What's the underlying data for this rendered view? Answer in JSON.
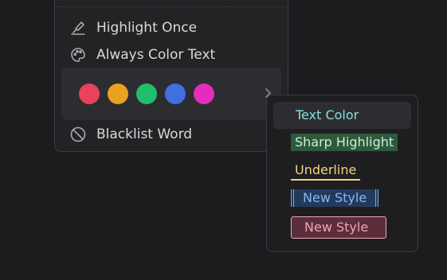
{
  "menu": {
    "items": [
      {
        "label": "Highlight Once",
        "icon": "highlighter-icon"
      },
      {
        "label": "Always Color Text",
        "icon": "palette-icon"
      },
      {
        "label": "Blacklist Word",
        "icon": "ban-icon"
      }
    ],
    "swatches": [
      {
        "name": "red",
        "color": "#e8435a"
      },
      {
        "name": "orange",
        "color": "#e8a21f"
      },
      {
        "name": "green",
        "color": "#21bf6b"
      },
      {
        "name": "blue",
        "color": "#3f6fe0"
      },
      {
        "name": "pink",
        "color": "#e32ebd"
      }
    ],
    "chevron_icon": "chevron-right-icon"
  },
  "submenu": {
    "items": [
      {
        "label": "Text Color",
        "style": "text-color",
        "color": "#7fe3e0"
      },
      {
        "label": "Sharp Highlight",
        "style": "sharp-highlight",
        "color": "#2d5a3c"
      },
      {
        "label": "Underline",
        "style": "underline",
        "color": "#f3d47a"
      },
      {
        "label": "New Style",
        "style": "bracketed-highlight",
        "color": "#233a5c"
      },
      {
        "label": "New Style",
        "style": "boxed-highlight",
        "color": "#5a2f3b"
      }
    ]
  }
}
